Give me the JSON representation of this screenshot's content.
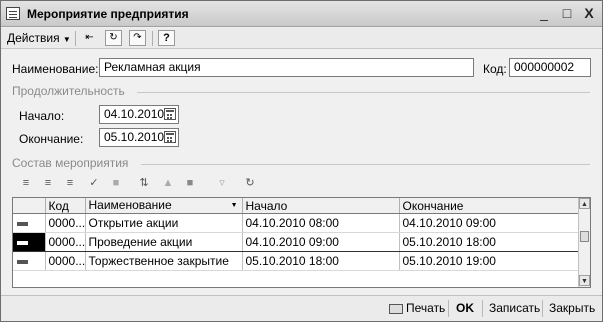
{
  "window": {
    "title": "Мероприятие предприятия",
    "minimize": "_",
    "maximize": "□",
    "close": "X"
  },
  "toolbar": {
    "actions_label": "Действия",
    "help_label": "?"
  },
  "form": {
    "name_label": "Наименование:",
    "name_value": "Рекламная акция",
    "code_label": "Код:",
    "code_value": "000000002",
    "duration_group": "Продолжительность",
    "start_label": "Начало:",
    "start_value": "04.10.2010",
    "end_label": "Окончание:",
    "end_value": "05.10.2010",
    "composition_group": "Состав мероприятия"
  },
  "grid": {
    "columns": [
      "Код",
      "Наименование",
      "Начало",
      "Окончание"
    ],
    "rows": [
      {
        "code": "0000...",
        "name": "Открытие акции",
        "start": "04.10.2010 08:00",
        "end": "04.10.2010 09:00"
      },
      {
        "code": "0000...",
        "name": "Проведение акции",
        "start": "04.10.2010 09:00",
        "end": "05.10.2010 18:00"
      },
      {
        "code": "0000...",
        "name": "Торжественное закрытие",
        "start": "05.10.2010 18:00",
        "end": "05.10.2010 19:00"
      }
    ]
  },
  "footer": {
    "print_label": "Печать",
    "ok_label": "OK",
    "save_label": "Записать",
    "close_label": "Закрыть"
  }
}
